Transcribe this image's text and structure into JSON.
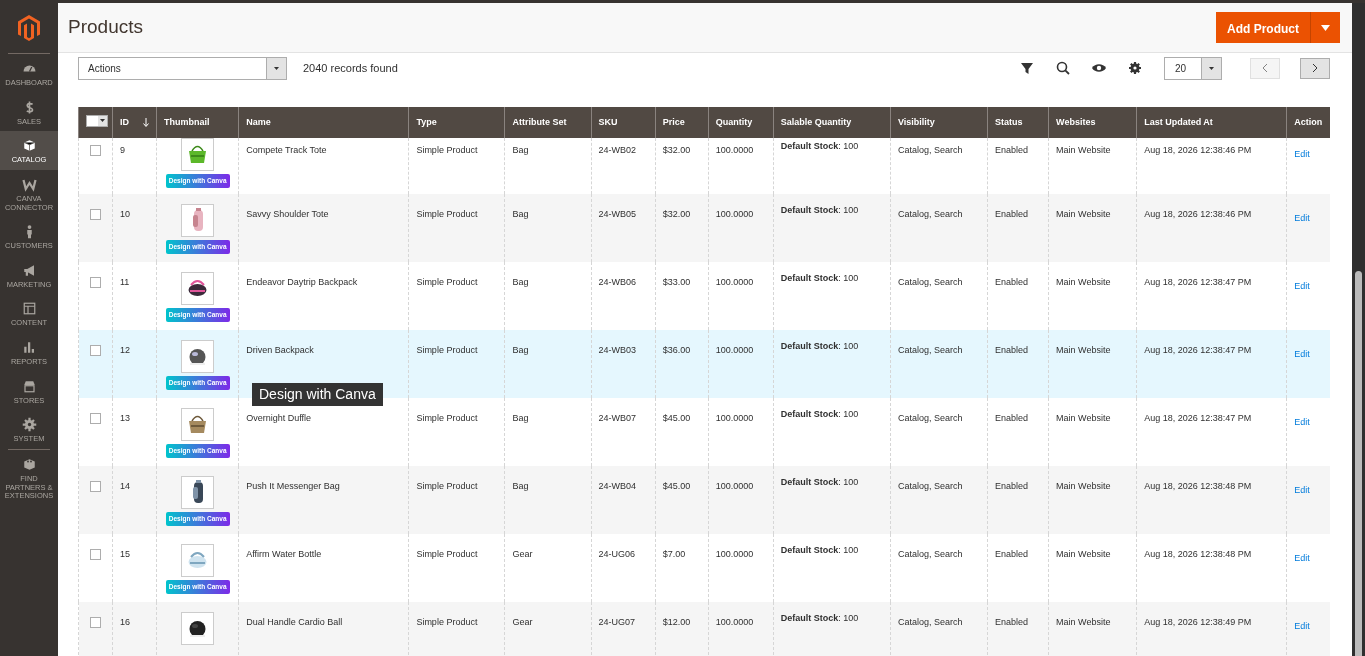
{
  "sidebar": {
    "items": [
      {
        "label": "DASHBOARD",
        "selected": false
      },
      {
        "label": "SALES",
        "selected": false
      },
      {
        "label": "CATALOG",
        "selected": true
      },
      {
        "label": "CANVA CONNECTOR",
        "selected": false
      },
      {
        "label": "CUSTOMERS",
        "selected": false
      },
      {
        "label": "MARKETING",
        "selected": false
      },
      {
        "label": "CONTENT",
        "selected": false
      },
      {
        "label": "REPORTS",
        "selected": false
      },
      {
        "label": "STORES",
        "selected": false
      },
      {
        "label": "SYSTEM",
        "selected": false
      },
      {
        "label": "FIND PARTNERS & EXTENSIONS",
        "selected": false
      }
    ]
  },
  "page": {
    "title": "Products",
    "add_button": "Add Product"
  },
  "toolbar": {
    "actions": "Actions",
    "records": "2040 records found",
    "page_size": "20",
    "prev_disabled": true,
    "next_disabled": false
  },
  "table": {
    "select_all_checked": false,
    "columns": [
      "ID",
      "Thumbnail",
      "Name",
      "Type",
      "Attribute Set",
      "SKU",
      "Price",
      "Quantity",
      "Salable Quantity",
      "Visibility",
      "Status",
      "Websites",
      "Last Updated At",
      "Action"
    ],
    "rows": [
      {
        "checked": false,
        "hovered": false,
        "id": "9",
        "badge": "Design with Canva",
        "name": "Compete Track Tote",
        "type": "Simple Product",
        "attribute_set": "Bag",
        "sku": "24-WB02",
        "price": "$32.00",
        "quantity": "100.0000",
        "salable": "**Default Stock**: 100",
        "visibility": "Catalog, Search",
        "status": "Enabled",
        "websites": "Main Website",
        "updated": "Aug 18, 2026 12:38:46 PM",
        "action": "Edit"
      },
      {
        "checked": false,
        "hovered": false,
        "id": "10",
        "badge": "Design with Canva",
        "name": "Savvy Shoulder Tote",
        "type": "Simple Product",
        "attribute_set": "Bag",
        "sku": "24-WB05",
        "price": "$32.00",
        "quantity": "100.0000",
        "salable": "**Default Stock**: 100",
        "visibility": "Catalog, Search",
        "status": "Enabled",
        "websites": "Main Website",
        "updated": "Aug 18, 2026 12:38:46 PM",
        "action": "Edit"
      },
      {
        "checked": false,
        "hovered": false,
        "id": "11",
        "badge": "Design with Canva",
        "name": "Endeavor Daytrip Backpack",
        "type": "Simple Product",
        "attribute_set": "Bag",
        "sku": "24-WB06",
        "price": "$33.00",
        "quantity": "100.0000",
        "salable": "**Default Stock**: 100",
        "visibility": "Catalog, Search",
        "status": "Enabled",
        "websites": "Main Website",
        "updated": "Aug 18, 2026 12:38:47 PM",
        "action": "Edit"
      },
      {
        "checked": false,
        "hovered": true,
        "id": "12",
        "badge": "Design with Canva",
        "name": "Driven Backpack",
        "type": "Simple Product",
        "attribute_set": "Bag",
        "sku": "24-WB03",
        "price": "$36.00",
        "quantity": "100.0000",
        "salable": "**Default Stock**: 100",
        "visibility": "Catalog, Search",
        "status": "Enabled",
        "websites": "Main Website",
        "updated": "Aug 18, 2026 12:38:47 PM",
        "action": "Edit"
      },
      {
        "checked": false,
        "hovered": false,
        "id": "13",
        "badge": "Design with Canva",
        "name": "Overnight Duffle",
        "type": "Simple Product",
        "attribute_set": "Bag",
        "sku": "24-WB07",
        "price": "$45.00",
        "quantity": "100.0000",
        "salable": "**Default Stock**: 100",
        "visibility": "Catalog, Search",
        "status": "Enabled",
        "websites": "Main Website",
        "updated": "Aug 18, 2026 12:38:47 PM",
        "action": "Edit"
      },
      {
        "checked": false,
        "hovered": false,
        "id": "14",
        "badge": "Design with Canva",
        "name": "Push It Messenger Bag",
        "type": "Simple Product",
        "attribute_set": "Bag",
        "sku": "24-WB04",
        "price": "$45.00",
        "quantity": "100.0000",
        "salable": "**Default Stock**: 100",
        "visibility": "Catalog, Search",
        "status": "Enabled",
        "websites": "Main Website",
        "updated": "Aug 18, 2026 12:38:48 PM",
        "action": "Edit"
      },
      {
        "checked": false,
        "hovered": false,
        "id": "15",
        "badge": "Design with Canva",
        "name": "Affirm Water Bottle",
        "type": "Simple Product",
        "attribute_set": "Gear",
        "sku": "24-UG06",
        "price": "$7.00",
        "quantity": "100.0000",
        "salable": "**Default Stock**: 100",
        "visibility": "Catalog, Search",
        "status": "Enabled",
        "websites": "Main Website",
        "updated": "Aug 18, 2026 12:38:48 PM",
        "action": "Edit"
      },
      {
        "checked": false,
        "hovered": false,
        "id": "16",
        "name": "Dual Handle Cardio Ball",
        "type": "Simple Product",
        "attribute_set": "Gear",
        "sku": "24-UG07",
        "price": "$12.00",
        "quantity": "100.0000",
        "salable": "**Default Stock**: 100",
        "visibility": "Catalog, Search",
        "status": "Enabled",
        "websites": "Main Website",
        "updated": "Aug 18, 2026 12:38:49 PM",
        "action": "Edit"
      }
    ]
  },
  "tooltip": "Design with Canva"
}
